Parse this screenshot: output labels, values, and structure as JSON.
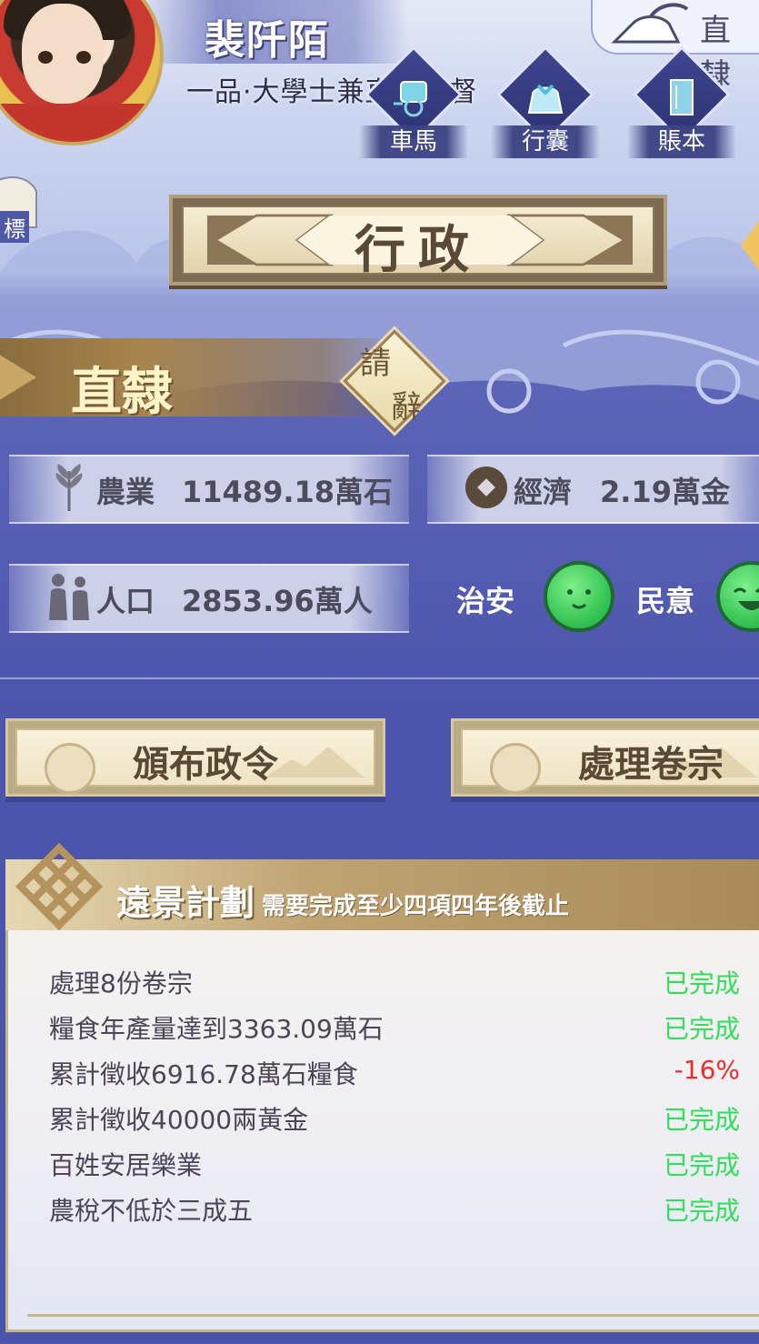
{
  "header": {
    "player_name": "裴阡陌",
    "player_title": "一品·大學士兼直隸總督",
    "province_corner": "直隸",
    "left_tab": "標",
    "quick_buttons": [
      {
        "label": "車馬",
        "icon": "carriage-icon"
      },
      {
        "label": "行囊",
        "icon": "bundle-icon"
      },
      {
        "label": "賬本",
        "icon": "ledger-icon"
      }
    ]
  },
  "section": {
    "title": "行政"
  },
  "province": {
    "name": "直隸",
    "resign_line1": "請",
    "resign_line2": "辭"
  },
  "stats": {
    "agriculture": {
      "label": "農業",
      "value": "11489.18萬石"
    },
    "economy": {
      "label": "經濟",
      "value": "2.19萬金"
    },
    "population": {
      "label": "人口",
      "value": "2853.96萬人"
    },
    "security": {
      "label": "治安",
      "mood": "happy"
    },
    "sentiment": {
      "label": "民意",
      "mood": "laughing"
    }
  },
  "actions": {
    "issue_decree": "頒布政令",
    "handle_files": "處理卷宗"
  },
  "plan": {
    "title": "遠景計劃",
    "subtitle": "需要完成至少四項四年後截止",
    "goals": [
      {
        "text": "處理8份卷宗",
        "status": "已完成",
        "done": true
      },
      {
        "text": "糧食年產量達到3363.09萬石",
        "status": "已完成",
        "done": true
      },
      {
        "text": "累計徵收6916.78萬石糧食",
        "status": "-16%",
        "done": false
      },
      {
        "text": "累計徵收40000兩黃金",
        "status": "已完成",
        "done": true
      },
      {
        "text": "百姓安居樂業",
        "status": "已完成",
        "done": true
      },
      {
        "text": "農稅不低於三成五",
        "status": "已完成",
        "done": true
      }
    ]
  },
  "colors": {
    "done": "#2ee05a",
    "progress": "#ee2a2a",
    "gold": "#a7844c",
    "panel_bg": "#4c55ac"
  }
}
